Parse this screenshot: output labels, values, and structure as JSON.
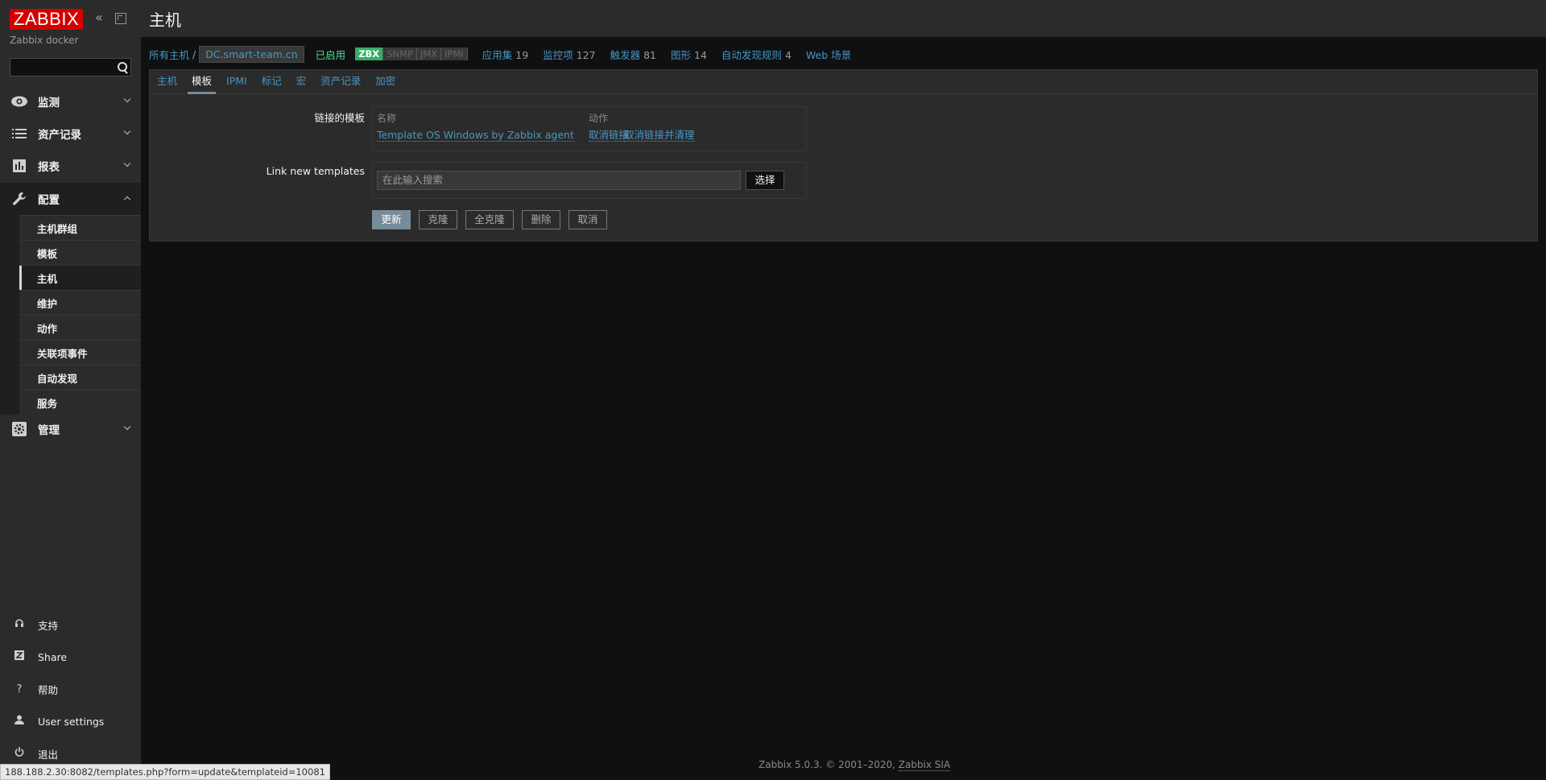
{
  "sidebar": {
    "logo": "ZABBIX",
    "server_name": "Zabbix docker",
    "menu": [
      {
        "label": "监测",
        "icon": "eye-icon"
      },
      {
        "label": "资产记录",
        "icon": "list-icon"
      },
      {
        "label": "报表",
        "icon": "bar-chart-icon"
      },
      {
        "label": "配置",
        "icon": "wrench-icon"
      },
      {
        "label": "管理",
        "icon": "gear-icon"
      }
    ],
    "config_submenu": [
      "主机群组",
      "模板",
      "主机",
      "维护",
      "动作",
      "关联项事件",
      "自动发现",
      "服务"
    ],
    "bottom": [
      {
        "label": "支持",
        "icon": "headset-icon"
      },
      {
        "label": "Share",
        "icon": "zabbix-share-icon"
      },
      {
        "label": "帮助",
        "icon": "question-icon"
      },
      {
        "label": "User settings",
        "icon": "user-icon"
      },
      {
        "label": "退出",
        "icon": "power-icon"
      }
    ]
  },
  "header": {
    "title": "主机"
  },
  "breadcrumb": {
    "all_hosts": "所有主机",
    "separator": "/",
    "host": "DC.smart-team.cn",
    "status": "已启用",
    "availability": [
      "ZBX",
      "SNMP",
      "JMX",
      "IPMI"
    ],
    "links": [
      {
        "label": "应用集",
        "count": "19"
      },
      {
        "label": "监控项",
        "count": "127"
      },
      {
        "label": "触发器",
        "count": "81"
      },
      {
        "label": "图形",
        "count": "14"
      },
      {
        "label": "自动发现规则",
        "count": "4"
      },
      {
        "label": "Web 场景",
        "count": ""
      }
    ]
  },
  "tabs": [
    "主机",
    "模板",
    "IPMI",
    "标记",
    "宏",
    "资产记录",
    "加密"
  ],
  "active_tab": "模板",
  "form": {
    "linked_label": "链接的模板",
    "col_name": "名称",
    "col_action": "动作",
    "linked_template": "Template OS Windows by Zabbix agent",
    "unlink": "取消链接",
    "unlink_clear": "取消链接并清理",
    "link_new_label": "Link new templates",
    "search_placeholder": "在此输入搜索",
    "select_button": "选择"
  },
  "buttons": {
    "update": "更新",
    "clone": "克隆",
    "full_clone": "全克隆",
    "delete": "删除",
    "cancel": "取消"
  },
  "footer": {
    "text": "Zabbix 5.0.3. © 2001–2020, ",
    "company": "Zabbix SIA"
  },
  "status_url": "188.188.2.30:8082/templates.php?form=update&templateid=10081"
}
